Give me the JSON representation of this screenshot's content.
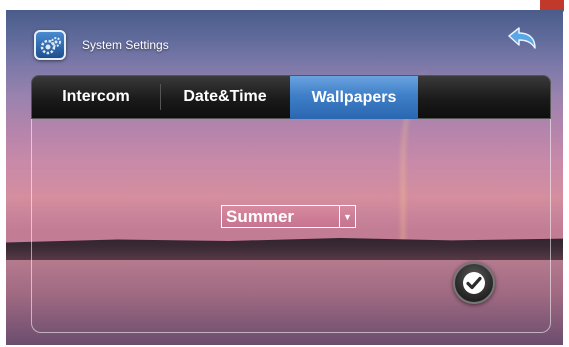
{
  "window": {
    "title": "System Settings"
  },
  "icons": {
    "app": "settings-gears-icon",
    "back": "back-arrow-icon",
    "confirm": "checkmark-icon",
    "dropdown": "triangle-down-icon"
  },
  "tabs": [
    {
      "label": "Intercom",
      "selected": false
    },
    {
      "label": "Date&Time",
      "selected": false
    },
    {
      "label": "Wallpapers",
      "selected": true
    }
  ],
  "wallpaper": {
    "selected": "Summer",
    "arrow_glyph": "▼"
  },
  "colors": {
    "tab_active": "#3f7fc8",
    "tab_bar": "#1a1a1a",
    "back_arrow": "#5ba7e6",
    "marker": "#c0392b"
  }
}
